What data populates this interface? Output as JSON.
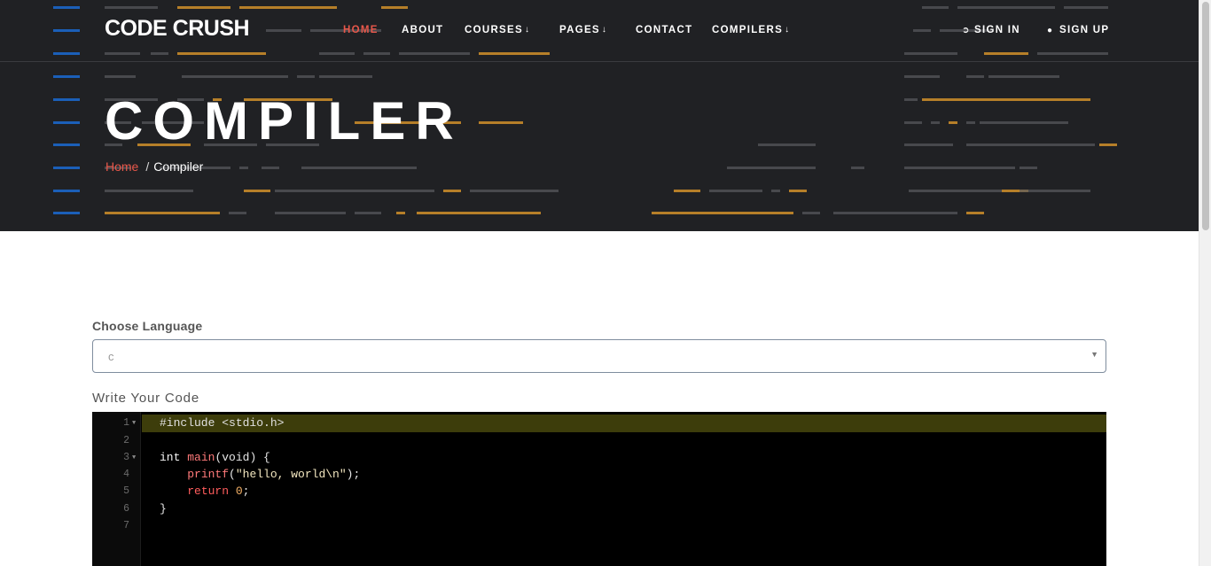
{
  "brand": {
    "name": "CODE CRUSH"
  },
  "nav": {
    "items": [
      {
        "label": "HOME",
        "active": true,
        "dropdown": false
      },
      {
        "label": "ABOUT",
        "active": false,
        "dropdown": false
      },
      {
        "label": "COURSES",
        "active": false,
        "dropdown": true
      },
      {
        "label": "PAGES",
        "active": false,
        "dropdown": true
      },
      {
        "label": "CONTACT",
        "active": false,
        "dropdown": false
      },
      {
        "label": "COMPILERS",
        "active": false,
        "dropdown": true
      }
    ],
    "auth": {
      "sign_in": "SIGN IN",
      "sign_up": "SIGN UP"
    }
  },
  "hero": {
    "title": "COMPILER",
    "breadcrumb": {
      "home": "Home",
      "separator": "/",
      "current": "Compiler"
    }
  },
  "form": {
    "language_label": "Choose Language",
    "language_selected": "c",
    "code_label": "Write Your Code"
  },
  "editor": {
    "lines": [
      {
        "n": "1",
        "fold": true,
        "text": "#include <stdio.h>"
      },
      {
        "n": "2",
        "fold": false,
        "text": ""
      },
      {
        "n": "3",
        "fold": true,
        "text": "int main(void) {"
      },
      {
        "n": "4",
        "fold": false,
        "text": "    printf(\"hello, world\\n\");"
      },
      {
        "n": "5",
        "fold": false,
        "text": "    return 0;"
      },
      {
        "n": "6",
        "fold": false,
        "text": "}"
      },
      {
        "n": "7",
        "fold": false,
        "text": ""
      }
    ],
    "tokens": {
      "include": "#include <stdio.h>",
      "int": "int",
      "main": "main",
      "main_args": "(void) {",
      "printf": "printf",
      "printf_open": "(",
      "printf_str": "\"hello, world\\n\"",
      "printf_close": ");",
      "return": "return",
      "return_val": "0",
      "return_end": ";",
      "close_brace": "}"
    },
    "theme": "monokai-like dark"
  },
  "colors": {
    "hero_bg": "#202124",
    "accent": "#e8574a",
    "editor_bg": "#000000",
    "active_line": "#3d3d0b",
    "deco_orange": "#d18f2a",
    "deco_blue": "#1b5fb8",
    "deco_gray": "#5a5b5f"
  },
  "icons": {
    "sign_in": "login-icon",
    "sign_up": "user-icon",
    "caret": "chevron-down-icon",
    "select_arrow": "triangle-down-icon"
  }
}
